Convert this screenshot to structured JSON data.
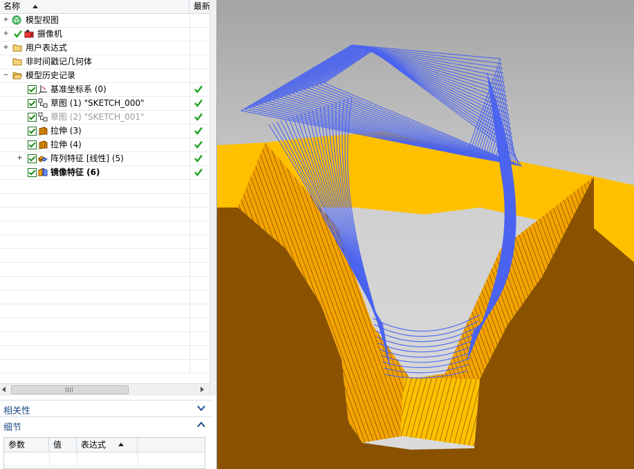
{
  "navigator": {
    "columns": {
      "name": "名称",
      "latest": "最新"
    },
    "tree": [
      {
        "label": "模型视图"
      },
      {
        "label": "摄像机"
      },
      {
        "label": "用户表达式"
      },
      {
        "label": "非时间戳记几何体"
      },
      {
        "label": "模型历史记录"
      },
      {
        "label": "基准坐标系 (0)"
      },
      {
        "label": "草图 (1) \"SKETCH_000\""
      },
      {
        "label": "草图 (2) \"SKETCH_001\""
      },
      {
        "label": "拉伸 (3)"
      },
      {
        "label": "拉伸 (4)"
      },
      {
        "label": "阵列特征 [线性] (5)"
      },
      {
        "label": "镜像特征 (6)"
      }
    ],
    "hscroll_grip": "III"
  },
  "panels": {
    "dependencies": {
      "title": "相关性"
    },
    "details": {
      "title": "细节",
      "columns": [
        "参数",
        "值",
        "表达式"
      ]
    }
  },
  "colors": {
    "accent": "#1b4d87",
    "check_green": "#1fa21f",
    "wire_blue": "#4a63f0",
    "face_orange": "#f5a300",
    "face_yellow": "#ffc000",
    "body_brown": "#8a5200",
    "background_gray": "#d2d2d2"
  },
  "icons": [
    "model-views-icon",
    "camera-icon",
    "folder-icon",
    "datum-csys-icon",
    "sketch-icon",
    "extrude-icon",
    "pattern-feature-icon",
    "mirror-feature-icon",
    "check-icon",
    "chevron-down-icon",
    "chevron-up-icon"
  ]
}
